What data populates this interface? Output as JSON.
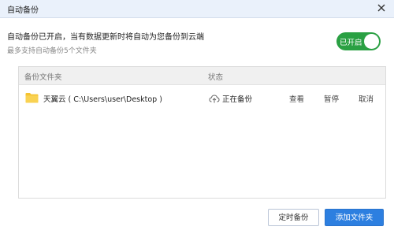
{
  "window": {
    "title": "自动备份"
  },
  "header": {
    "headline": "自动备份已开启，当有数据更新时将自动为您备份到云端",
    "subline": "最多支持自动备份5个文件夹"
  },
  "toggle": {
    "label": "已开启",
    "on": true,
    "color": "#2aa043"
  },
  "table": {
    "columns": [
      "备份文件夹",
      "状态"
    ],
    "rows": [
      {
        "folder": "天翼云 ( C:\\Users\\user\\Desktop )",
        "status": "正在备份",
        "actions": [
          "查看",
          "暂停",
          "取消"
        ]
      }
    ]
  },
  "footer": {
    "schedule_label": "定时备份",
    "add_label": "添加文件夹"
  },
  "colors": {
    "accent": "#2d7fe0",
    "folder": "#f5c330"
  },
  "icons": {
    "close": "close-icon",
    "folder": "folder-icon",
    "status": "cloud-upload-icon"
  }
}
